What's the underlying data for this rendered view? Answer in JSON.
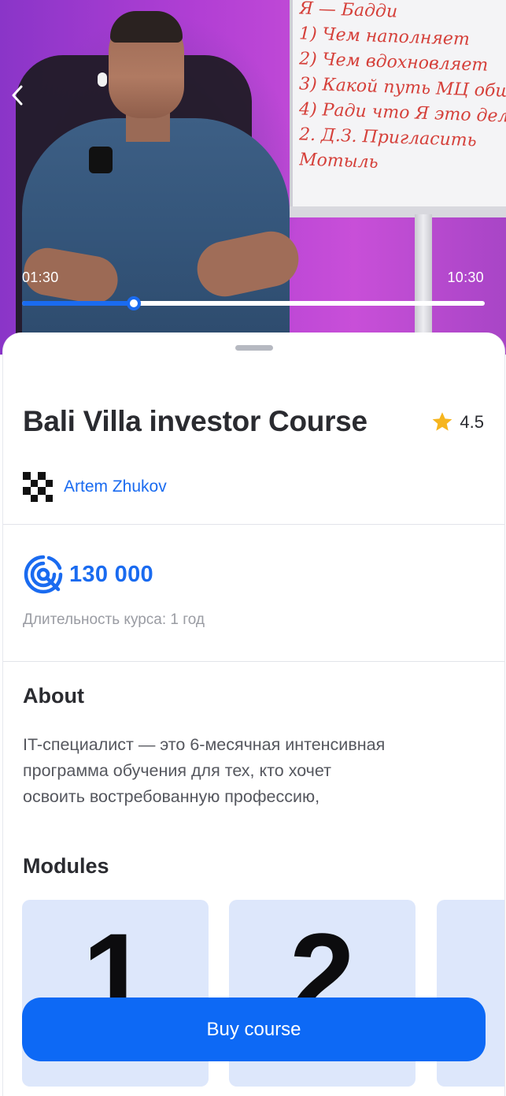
{
  "video": {
    "current_time": "01:30",
    "total_time": "10:30",
    "progress_fraction": 0.241,
    "board_lines": [
      "Я — Бадди",
      "1) Чем наполняет",
      "2) Чем вдохновляет",
      "3) Какой путь МЦ общ",
      "4) Ради что Я это дел",
      "2. Д.З. Пригласить",
      "Мотыль"
    ]
  },
  "course": {
    "title": "Bali Villa investor Course",
    "rating": "4.5",
    "author": "Artem Zhukov",
    "price": "130 000",
    "duration": "Длительность курса: 1 год"
  },
  "about": {
    "heading": "About",
    "text": "IT-специалист — это 6-месячная интенсивная программа обучения для тех, кто хочет освоить востребованную профессию,"
  },
  "modules": {
    "heading": "Modules",
    "items": [
      {
        "number": "1"
      },
      {
        "number": "2"
      },
      {
        "number": ""
      }
    ]
  },
  "actions": {
    "buy_label": "Buy course"
  },
  "colors": {
    "accent": "#0d69f5",
    "star": "#f6b51e",
    "module_bg": "#dde7fb"
  }
}
